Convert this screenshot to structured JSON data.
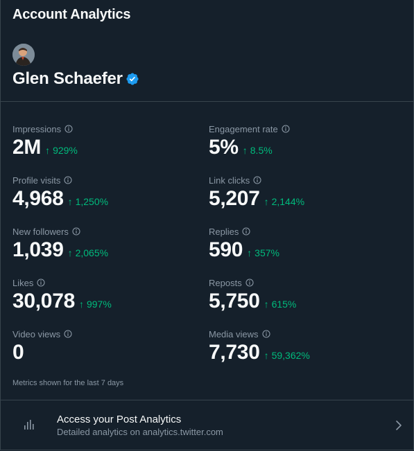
{
  "header": {
    "title": "Account Analytics"
  },
  "profile": {
    "name": "Glen Schaefer",
    "verified": true
  },
  "metrics": [
    {
      "label": "Impressions",
      "value": "2M",
      "change": "929%",
      "direction": "up"
    },
    {
      "label": "Engagement rate",
      "value": "5%",
      "change": "8.5%",
      "direction": "up"
    },
    {
      "label": "Profile visits",
      "value": "4,968",
      "change": "1,250%",
      "direction": "up"
    },
    {
      "label": "Link clicks",
      "value": "5,207",
      "change": "2,144%",
      "direction": "up"
    },
    {
      "label": "New followers",
      "value": "1,039",
      "change": "2,065%",
      "direction": "up"
    },
    {
      "label": "Replies",
      "value": "590",
      "change": "357%",
      "direction": "up"
    },
    {
      "label": "Likes",
      "value": "30,078",
      "change": "997%",
      "direction": "up"
    },
    {
      "label": "Reposts",
      "value": "5,750",
      "change": "615%",
      "direction": "up"
    },
    {
      "label": "Video views",
      "value": "0",
      "change": "",
      "direction": ""
    },
    {
      "label": "Media views",
      "value": "7,730",
      "change": "59,362%",
      "direction": "up"
    }
  ],
  "footnote": "Metrics shown for the last 7 days",
  "post_analytics": {
    "title": "Access your Post Analytics",
    "subtitle": "Detailed analytics on analytics.twitter.com",
    "icon": "bar-chart-icon"
  },
  "colors": {
    "background": "#15202b",
    "positive": "#00ba7c",
    "muted": "#8b98a5",
    "verified": "#1d9bf0",
    "border": "#38444d"
  }
}
